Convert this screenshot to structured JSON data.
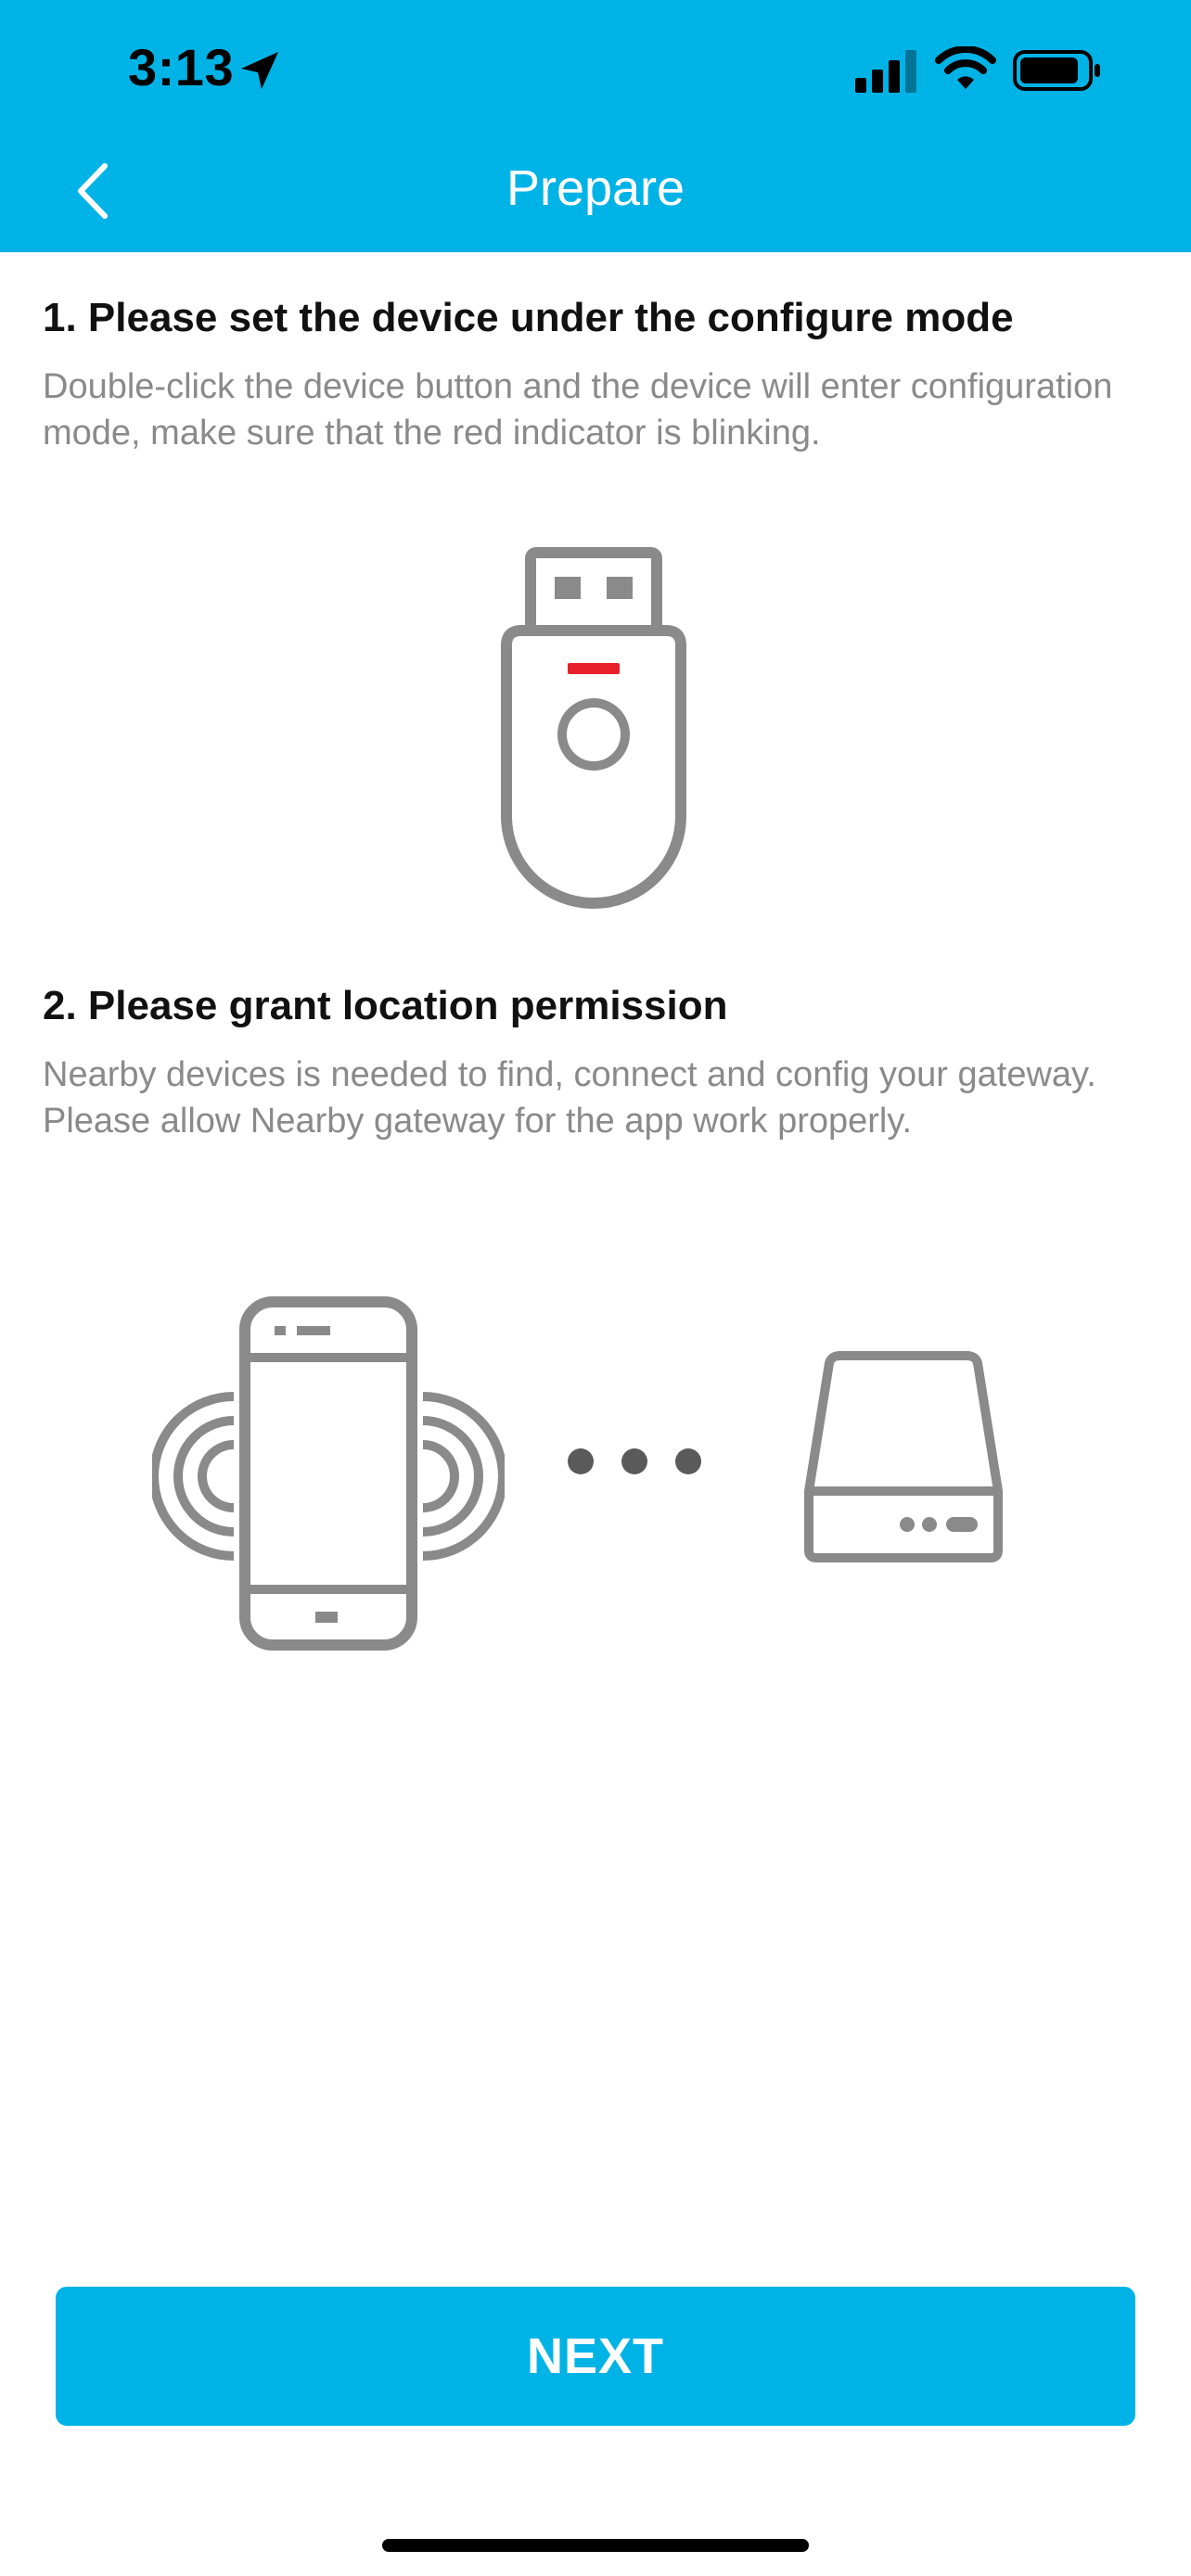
{
  "status_bar": {
    "time": "3:13",
    "icons": [
      "location-arrow-icon",
      "cellular-signal-icon",
      "wifi-icon",
      "battery-icon"
    ]
  },
  "nav": {
    "title": "Prepare",
    "back_icon": "chevron-left-icon"
  },
  "steps": [
    {
      "title": "1. Please set the device under the configure mode",
      "description": "Double-click the device button and the device will enter configuration mode, make sure that the red indicator is blinking.",
      "illustration": "usb-dongle-icon"
    },
    {
      "title": "2. Please grant location permission",
      "description": "Nearby devices is needed to find, connect and config your gateway. Please allow Nearby gateway for the app work properly.",
      "illustration": "phone-to-gateway-icon"
    }
  ],
  "next_button": {
    "label": "NEXT"
  },
  "colors": {
    "brand": "#00b3e6",
    "indicator": "#e8202a",
    "illustration_gray": "#8a8a8a",
    "description_gray": "#8a8a8a"
  }
}
